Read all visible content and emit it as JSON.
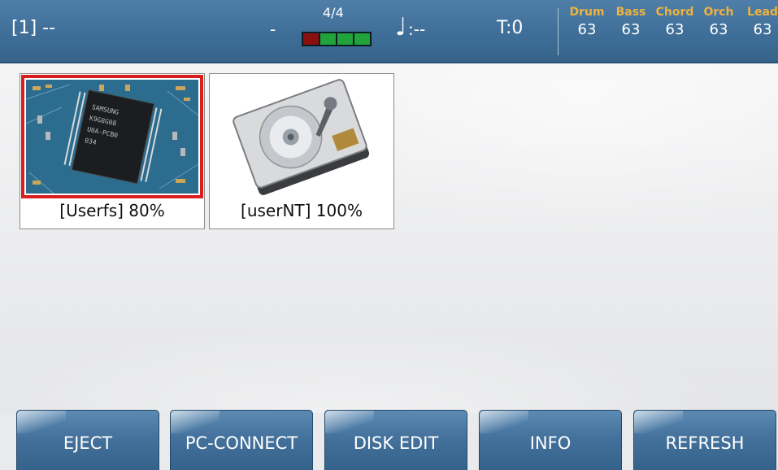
{
  "status": {
    "song_id": "[1] --",
    "dash": "-",
    "time_signature": "4/4",
    "beat_colors": [
      "#8a1010",
      "#1fa33a",
      "#1fa33a",
      "#1fa33a"
    ],
    "note_glyph": "♩",
    "note_value": ":--",
    "tempo": "T:0",
    "volumes": [
      {
        "name": "Drum",
        "value": "63"
      },
      {
        "name": "Bass",
        "value": "63"
      },
      {
        "name": "Chord",
        "value": "63"
      },
      {
        "name": "Orch",
        "value": "63"
      },
      {
        "name": "Lead",
        "value": "63"
      }
    ]
  },
  "drives": [
    {
      "label": "[Userfs] 80%",
      "icon": "memory-chip-icon",
      "selected": true
    },
    {
      "label": "[userNT] 100%",
      "icon": "hard-disk-icon",
      "selected": false
    }
  ],
  "buttons": {
    "eject": "EJECT",
    "pc_connect": "PC-CONNECT",
    "disk_edit": "DISK EDIT",
    "info": "INFO",
    "refresh": "REFRESH"
  },
  "colors": {
    "bar_blue": "#3f6f99",
    "accent_orange": "#f0b23a",
    "selection_red": "#d81e1e"
  }
}
